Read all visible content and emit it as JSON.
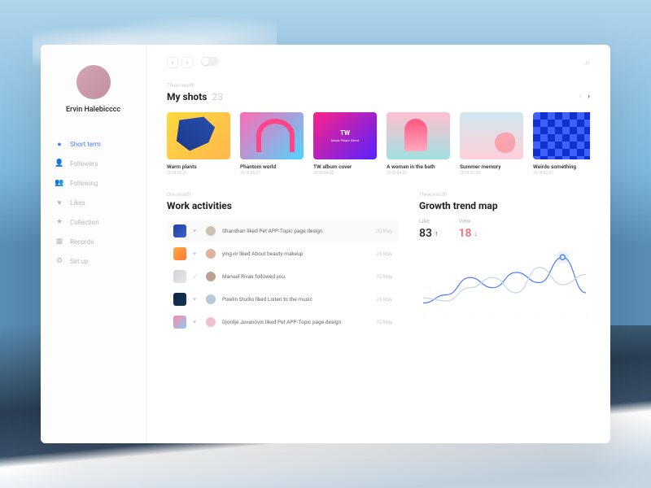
{
  "user": {
    "name": "Ervin Halebicccc"
  },
  "sidebar": {
    "items": [
      {
        "label": "Short term",
        "icon": "●",
        "active": true
      },
      {
        "label": "Followers",
        "icon": "👤"
      },
      {
        "label": "Following",
        "icon": "👥"
      },
      {
        "label": "Likes",
        "icon": "♥"
      },
      {
        "label": "Collection",
        "icon": "★"
      },
      {
        "label": "Records",
        "icon": "▦"
      },
      {
        "label": "Set up",
        "icon": "⚙"
      }
    ]
  },
  "shots": {
    "period": "Three month",
    "title": "My shots",
    "count": "23",
    "items": [
      {
        "title": "Warm plants",
        "date": "2018-05-21"
      },
      {
        "title": "Phantom world",
        "date": "2018-05-01"
      },
      {
        "title": "TW album cover",
        "date": "2018-04-20",
        "badge": "TW",
        "badge_sub": "Music Player Client"
      },
      {
        "title": "A woman in the bath",
        "date": "2018-04-03"
      },
      {
        "title": "Summer memory",
        "date": "2018-02-23"
      },
      {
        "title": "Weirdo something",
        "date": "2018-02-01"
      }
    ]
  },
  "activities": {
    "period": "One month",
    "title": "Work activities",
    "items": [
      {
        "text": "Shanshan liked Pet APP-Topic page design",
        "date": "25 May",
        "icon": "♥"
      },
      {
        "text": "ying-nr liked About beauty makeup",
        "date": "25 May",
        "icon": "♥"
      },
      {
        "text": "Manuel Rivas followed you.",
        "date": "25 May",
        "icon": "✓"
      },
      {
        "text": "Pixelin Studio liked Listen to the music",
        "date": "25 May",
        "icon": "♥"
      },
      {
        "text": "Djordje Jovanovic liked Pet APP-Topic page design",
        "date": "25 May",
        "icon": "♥"
      }
    ]
  },
  "growth": {
    "period": "Three month",
    "title": "Growth trend map",
    "stats": [
      {
        "label": "Like",
        "value": "83",
        "trend": "↑",
        "dir": "up"
      },
      {
        "label": "View",
        "value": "18",
        "trend": "↓",
        "dir": "down"
      }
    ]
  },
  "chart_data": {
    "type": "line",
    "x": [
      0,
      1,
      2,
      3,
      4,
      5,
      6,
      7
    ],
    "series": [
      {
        "name": "Like",
        "values": [
          10,
          18,
          35,
          25,
          40,
          30,
          55,
          20
        ],
        "color": "#4a7fff"
      },
      {
        "name": "View",
        "values": [
          15,
          12,
          25,
          35,
          20,
          45,
          28,
          38
        ],
        "color": "#c5d5ea"
      }
    ],
    "ylim": [
      0,
      60
    ]
  }
}
